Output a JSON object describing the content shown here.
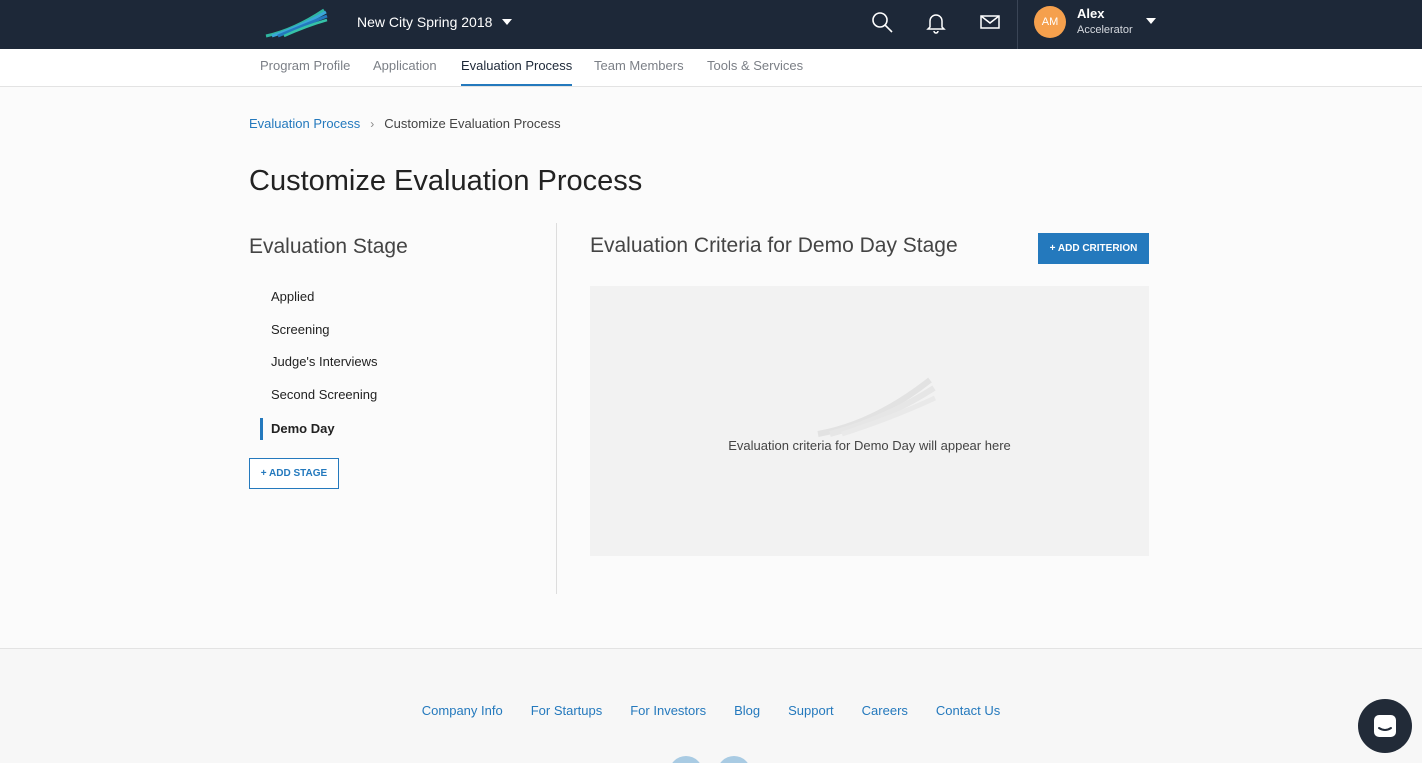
{
  "header": {
    "program_name": "New City Spring 2018",
    "user": {
      "initials": "AM",
      "name": "Alex",
      "role": "Accelerator"
    },
    "icons": [
      "search-icon",
      "bell-icon",
      "mail-icon"
    ],
    "avatar_color": "#f5a04d",
    "bar_color": "#1d2838"
  },
  "subnav": {
    "items": [
      "Program Profile",
      "Application",
      "Evaluation Process",
      "Team Members",
      "Tools & Services"
    ],
    "active": "Evaluation Process"
  },
  "breadcrumb": {
    "parent": "Evaluation Process",
    "current": "Customize Evaluation Process"
  },
  "page_title": "Customize Evaluation Process",
  "stages": {
    "heading": "Evaluation Stage",
    "items": [
      "Applied",
      "Screening",
      "Judge's Interviews",
      "Second Screening",
      "Demo Day"
    ],
    "active": "Demo Day",
    "add_label": "+ ADD STAGE"
  },
  "criteria": {
    "heading": "Evaluation Criteria for Demo Day Stage",
    "add_label": "+ ADD CRITERION",
    "empty_message": "Evaluation criteria for Demo Day will appear here"
  },
  "footer": {
    "links": [
      "Company Info",
      "For Startups",
      "For Investors",
      "Blog",
      "Support",
      "Careers",
      "Contact Us"
    ]
  },
  "accent_color": "#2479bd"
}
